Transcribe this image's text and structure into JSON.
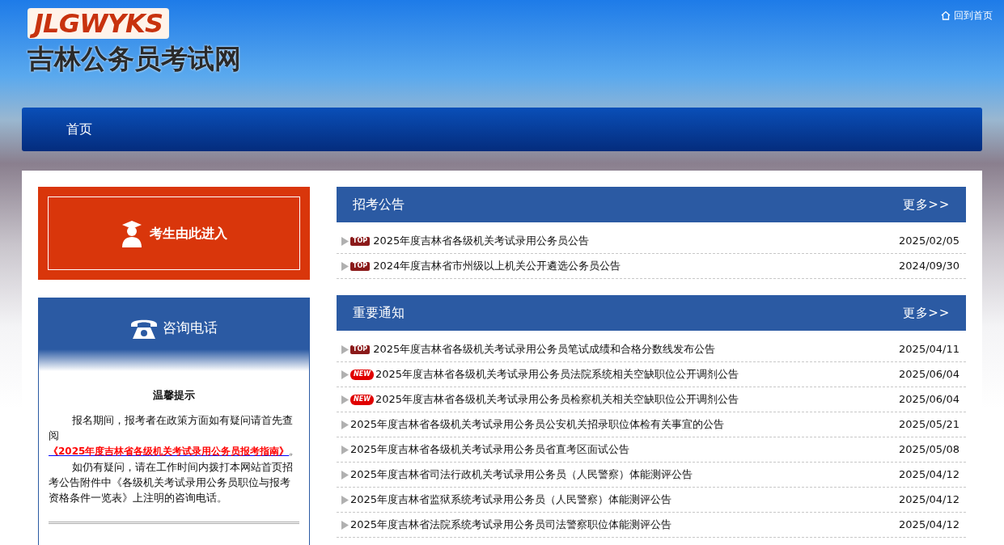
{
  "header": {
    "logo_latin": "JLGWYKS",
    "logo_title": "吉林公务员考试网",
    "home_link": "回到首页"
  },
  "nav": {
    "items": [
      {
        "label": "首页",
        "selected": false
      }
    ]
  },
  "entry_button": {
    "label": "考生由此进入"
  },
  "consult": {
    "title": "咨询电话",
    "notice_title": "温馨提示",
    "para1_before": "报名期间，报考者在政策方面如有疑问请首先查阅",
    "para1_link": "《2025年度吉林省各级机关考试录用公务员报考指南》",
    "para1_after": "。",
    "para2": "如仍有疑问，请在工作时间内拨打本网站首页招考公告附件中《各级机关考试录用公务员职位与报考资格条件一览表》上注明的咨询电话。"
  },
  "sections": [
    {
      "title": "招考公告",
      "more": "更多>>",
      "items": [
        {
          "kind": "top",
          "badge": "TOP",
          "title": "2025年度吉林省各级机关考试录用公务员公告",
          "date": "2025/02/05"
        },
        {
          "kind": "top",
          "badge": "TOP",
          "title": "2024年度吉林省市州级以上机关公开遴选公务员公告",
          "date": "2024/09/30"
        }
      ]
    },
    {
      "title": "重要通知",
      "more": "更多>>",
      "items": [
        {
          "kind": "top",
          "badge": "TOP",
          "title": "2025年度吉林省各级机关考试录用公务员笔试成绩和合格分数线发布公告",
          "date": "2025/04/11"
        },
        {
          "kind": "new",
          "badge": "NEW",
          "title": "2025年度吉林省各级机关考试录用公务员法院系统相关空缺职位公开调剂公告",
          "date": "2025/06/04"
        },
        {
          "kind": "new",
          "badge": "NEW",
          "title": "2025年度吉林省各级机关考试录用公务员检察机关相关空缺职位公开调剂公告",
          "date": "2025/06/04"
        },
        {
          "kind": "plain",
          "title": "2025年度吉林省各级机关考试录用公务员公安机关招录职位体检有关事宜的公告",
          "date": "2025/05/21"
        },
        {
          "kind": "plain",
          "title": "2025年度吉林省各级机关考试录用公务员省直考区面试公告",
          "date": "2025/05/08"
        },
        {
          "kind": "plain",
          "title": "2025年度吉林省司法行政机关考试录用公务员（人民警察）体能测评公告",
          "date": "2025/04/12"
        },
        {
          "kind": "plain",
          "title": "2025年度吉林省监狱系统考试录用公务员（人民警察）体能测评公告",
          "date": "2025/04/12"
        },
        {
          "kind": "plain",
          "title": "2025年度吉林省法院系统考试录用公务员司法警察职位体能测评公告",
          "date": "2025/04/12"
        }
      ]
    }
  ]
}
